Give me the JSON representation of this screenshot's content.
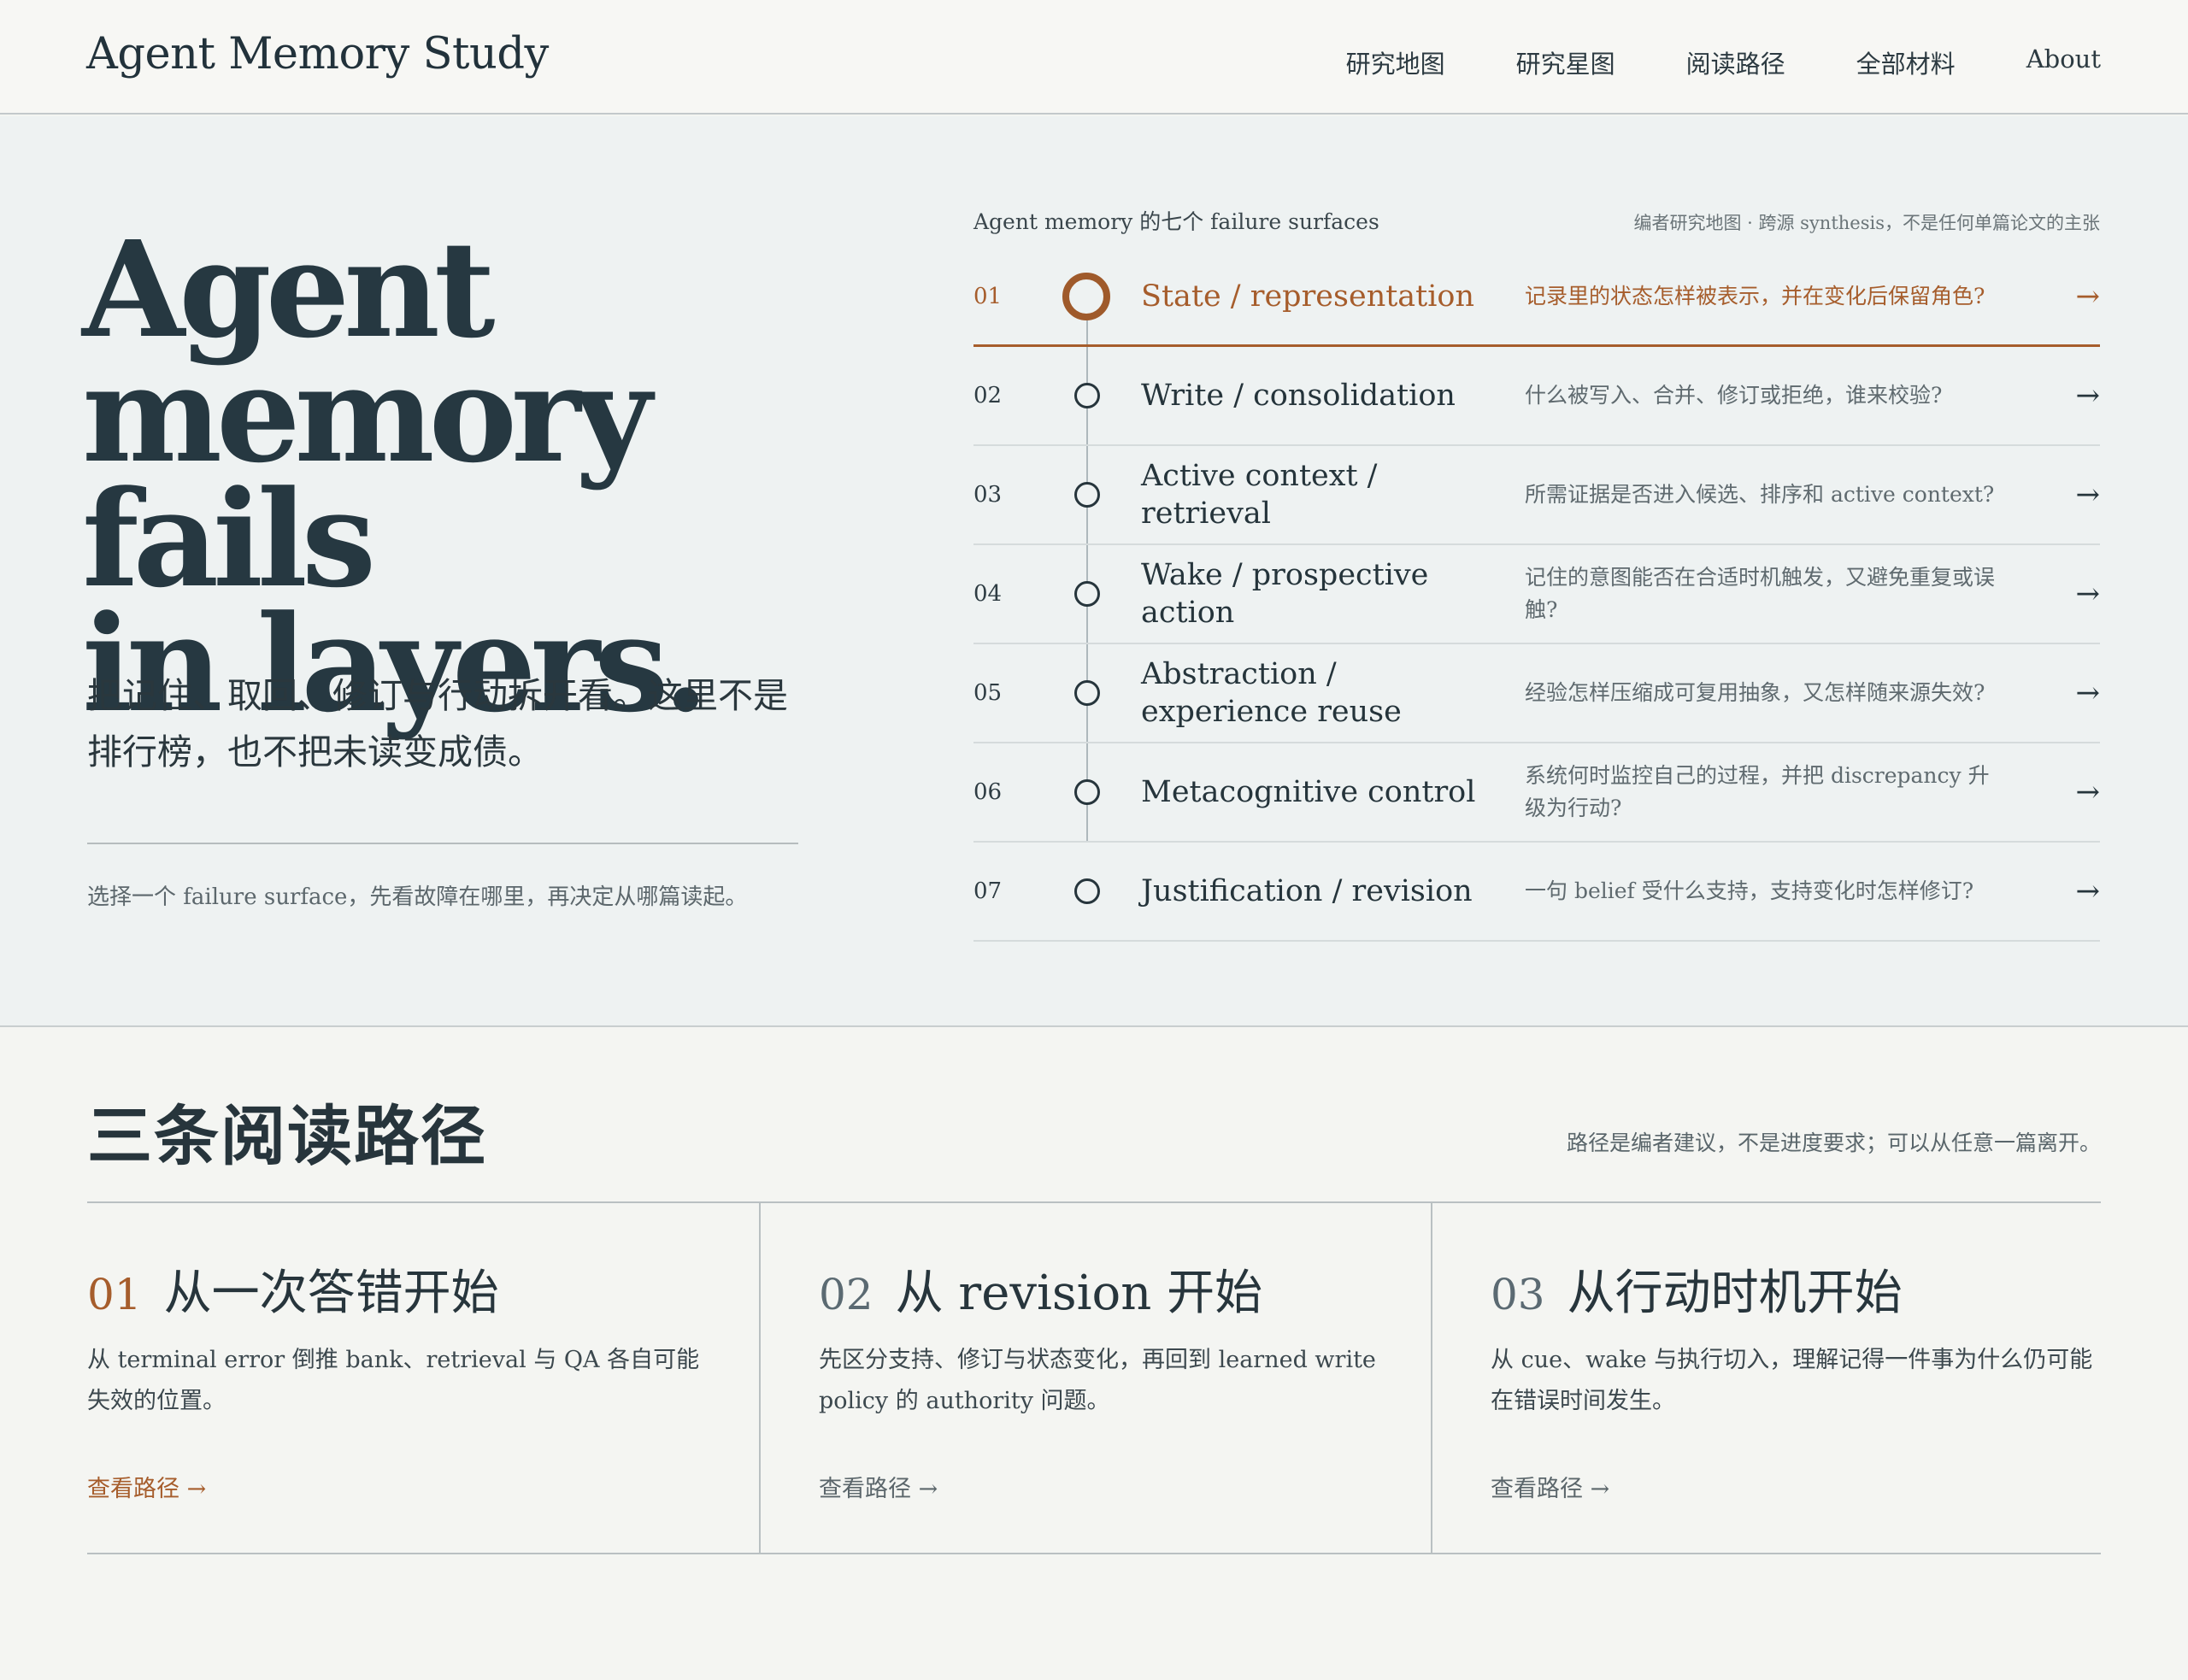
{
  "header": {
    "brand": "Agent Memory Study",
    "nav": [
      "研究地图",
      "研究星图",
      "阅读路径",
      "全部材料",
      "About"
    ]
  },
  "hero": {
    "headline": [
      "Agent",
      "memory fails",
      "in layers."
    ],
    "lede": "把记住、取回、修订与行动拆开看。这里不是排行榜，也不把未读变成债。",
    "hint": "选择一个 failure surface，先看故障在哪里，再决定从哪篇读起。"
  },
  "map": {
    "title": "Agent memory 的七个 failure surfaces",
    "note": "编者研究地图 · 跨源 synthesis，不是任何单篇论文的主张",
    "arrow": "→",
    "active_index": 0,
    "surfaces": [
      {
        "num": "01",
        "label": "State / representation",
        "desc": "记录里的状态怎样被表示，并在变化后保留角色?"
      },
      {
        "num": "02",
        "label": "Write / consolidation",
        "desc": "什么被写入、合并、修订或拒绝，谁来校验?"
      },
      {
        "num": "03",
        "label": "Active context / retrieval",
        "desc": "所需证据是否进入候选、排序和 active context?"
      },
      {
        "num": "04",
        "label": "Wake / prospective action",
        "desc": "记住的意图能否在合适时机触发，又避免重复或误触?"
      },
      {
        "num": "05",
        "label": "Abstraction / experience reuse",
        "desc": "经验怎样压缩成可复用抽象，又怎样随来源失效?"
      },
      {
        "num": "06",
        "label": "Metacognitive control",
        "desc": "系统何时监控自己的过程，并把 discrepancy 升级为行动?"
      },
      {
        "num": "07",
        "label": "Justification / revision",
        "desc": "一句 belief 受什么支持，支持变化时怎样修订?"
      }
    ]
  },
  "paths": {
    "title": "三条阅读路径",
    "note": "路径是编者建议，不是进度要求；可以从任意一篇离开。",
    "items": [
      {
        "num": "01",
        "title": "从一次答错开始",
        "body": "从 terminal error 倒推 bank、retrieval 与 QA 各自可能失效的位置。",
        "link": "查看路径 →"
      },
      {
        "num": "02",
        "title": "从 revision 开始",
        "body": "先区分支持、修订与状态变化，再回到 learned write policy 的 authority 问题。",
        "link": "查看路径 →"
      },
      {
        "num": "03",
        "title": "从行动时机开始",
        "body": "从 cue、wake 与执行切入，理解记得一件事为什么仍可能在错误时间发生。",
        "link": "查看路径 →"
      }
    ]
  },
  "colors": {
    "accent": "#a65d2c",
    "ink": "#27353c",
    "hero_bg": "#eef2f2",
    "page_bg": "#f4f5f2"
  }
}
